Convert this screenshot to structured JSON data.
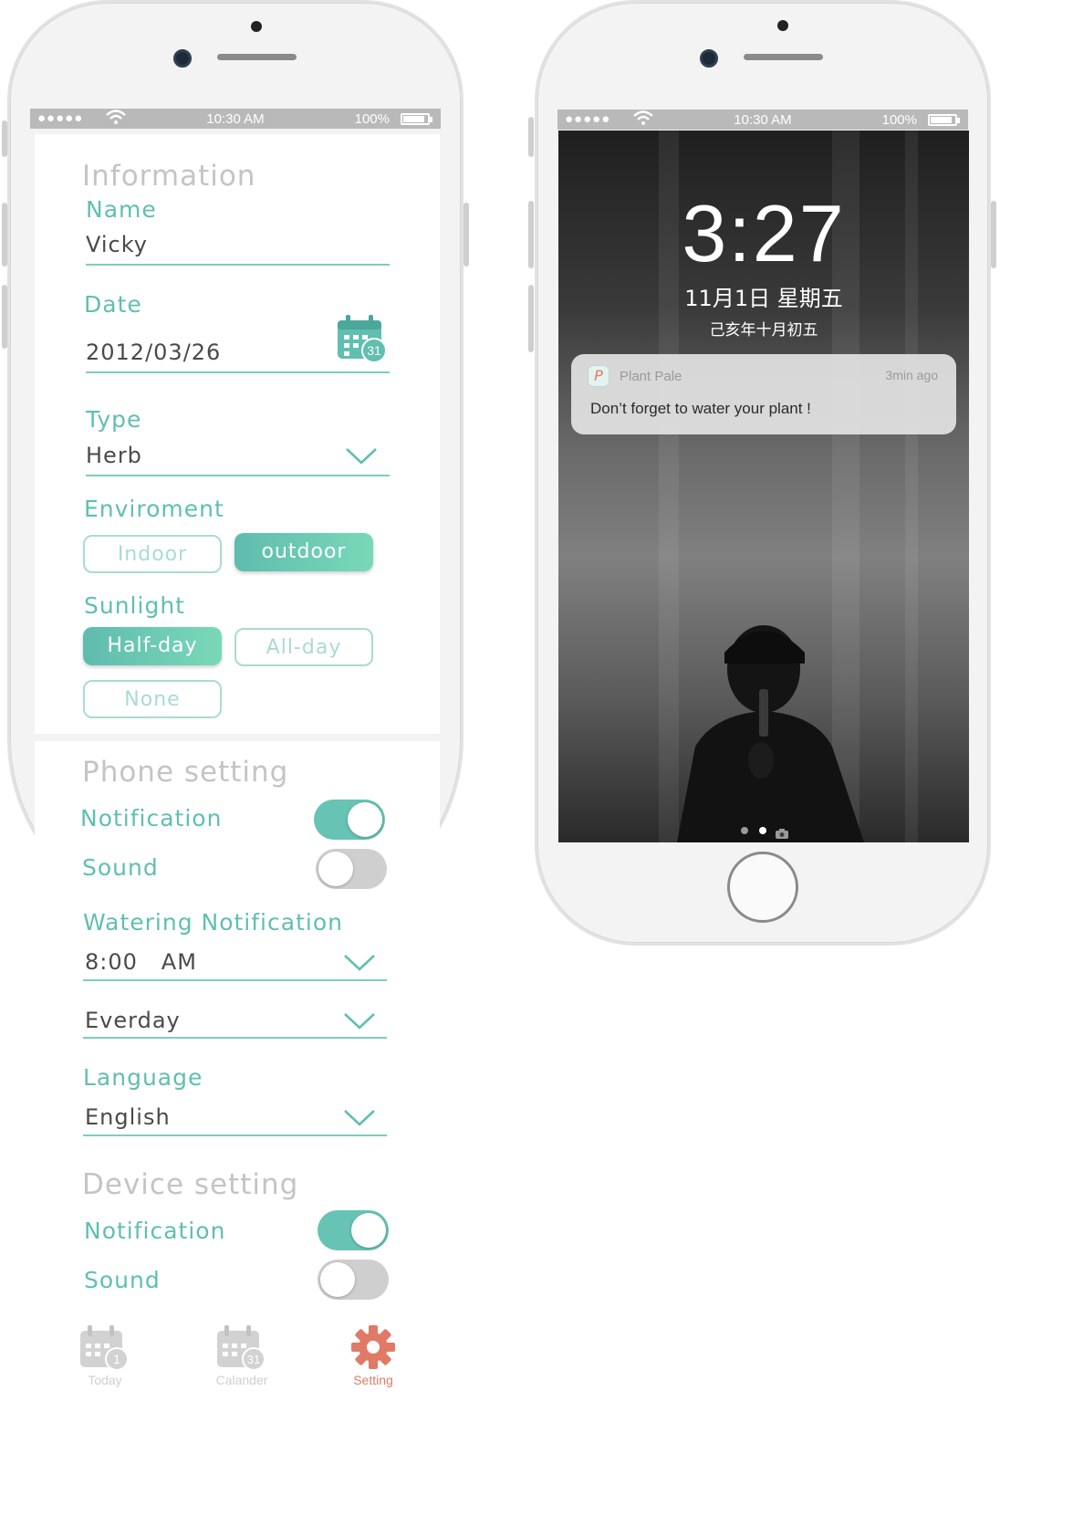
{
  "status_bar": {
    "left_phone": {
      "signal": "●●●●●",
      "time": "10:30 AM",
      "battery": "100%"
    },
    "right_phone": {
      "signal": "●●●●●",
      "time": "10:30 AM",
      "battery": "100%"
    }
  },
  "information": {
    "section_title": "Information",
    "name_label": "Name",
    "name_value": "Vicky",
    "date_label": "Date",
    "date_value": "2012/03/26",
    "calendar_badge": "31",
    "type_label": "Type",
    "type_value": "Herb",
    "environment_label": "Enviroment",
    "environment_options": {
      "indoor": "Indoor",
      "outdoor": "outdoor"
    },
    "environment_selected": "outdoor",
    "sunlight_label": "Sunlight",
    "sunlight_options": {
      "half_day": "Half-day",
      "all_day": "All-day",
      "none": "None"
    },
    "sunlight_selected": "Half-day"
  },
  "phone_setting": {
    "section_title": "Phone setting",
    "notification_label": "Notification",
    "notification_on": true,
    "sound_label": "Sound",
    "sound_on": false,
    "watering_label": "Watering Notification",
    "watering_time": "8:00   AM",
    "watering_frequency": "Everday",
    "language_label": "Language",
    "language_value": "English"
  },
  "device_setting": {
    "section_title": "Device setting",
    "notification_label": "Notification",
    "notification_on": true,
    "sound_label": "Sound",
    "sound_on": false
  },
  "tab_bar": {
    "tabs": [
      {
        "label": "Today",
        "badge": "1",
        "active": false
      },
      {
        "label": "Calander",
        "badge": "31",
        "active": false
      },
      {
        "label": "Setting",
        "active": true
      }
    ]
  },
  "lock_screen": {
    "time": "3:27",
    "date": "11月1日 星期五",
    "lunar_date": "己亥年十月初五",
    "notification": {
      "app_name": "Plant Pale",
      "app_icon_letter": "P",
      "time_ago": "3min ago",
      "message": "Don’t forget to water your plant !"
    }
  },
  "colors": {
    "accent_teal": "#5fbfb1",
    "toggle_on": "#67c3b4",
    "active_tab": "#e07a66",
    "inactive_tab": "#cfcfcf"
  },
  "icons": [
    "calendar-icon",
    "chevron-down-icon",
    "gear-icon",
    "wifi-icon",
    "battery-icon",
    "camera-icon"
  ]
}
